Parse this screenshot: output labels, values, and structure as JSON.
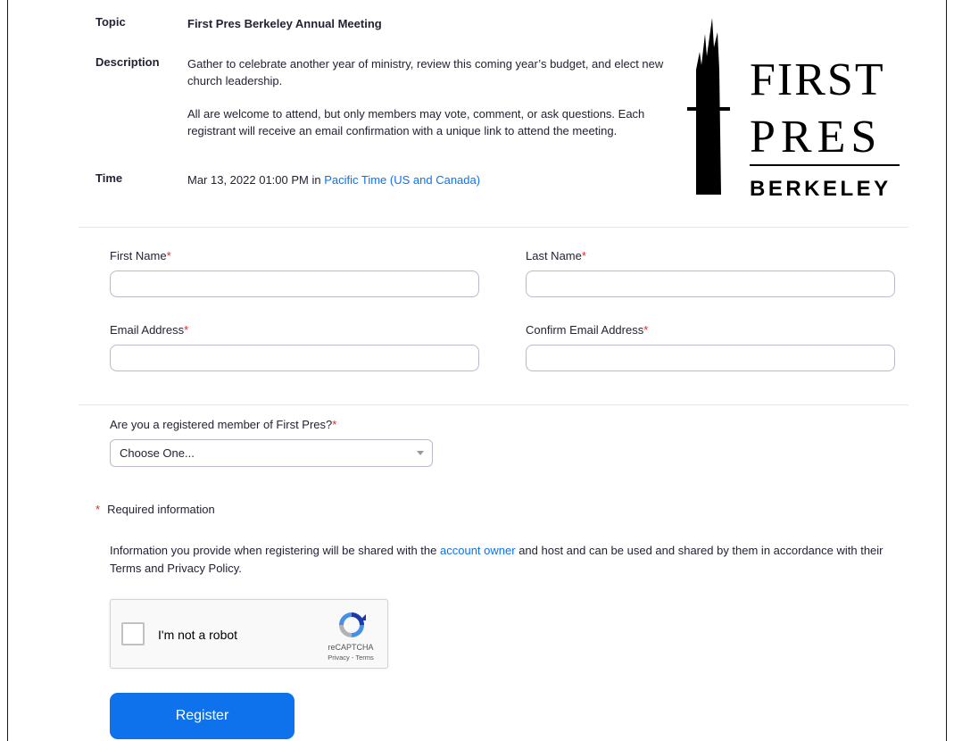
{
  "meeting": {
    "topic_label": "Topic",
    "topic": "First Pres Berkeley Annual Meeting",
    "description_label": "Description",
    "description_p1": "Gather to celebrate another year of ministry, review this coming year’s budget, and elect new church leadership.",
    "description_p2": "All are welcome to attend, but only members may vote, comment, or ask questions. Each registrant will receive an email confirmation with a unique link to attend the meeting.",
    "time_label": "Time",
    "time_value": "Mar 13, 2022 01:00 PM in",
    "timezone_link": "Pacific Time (US and Canada)"
  },
  "logo": {
    "line1": "FIRST",
    "line2": "PRES",
    "line3": "BERKELEY",
    "icon": "church-spire-cross-logo"
  },
  "form": {
    "required_mark": "*",
    "first_name_label": "First Name",
    "last_name_label": "Last Name",
    "email_label": "Email Address",
    "confirm_email_label": "Confirm Email Address",
    "first_name_value": "",
    "last_name_value": "",
    "email_value": "",
    "confirm_email_value": "",
    "member_question": "Are you a registered member of First Pres?",
    "member_selected": "Choose One...",
    "required_info": "Required information"
  },
  "disclaimer": {
    "before": "Information you provide when registering will be shared with the",
    "link": "account owner",
    "after": "and host and can be used and shared by them in accordance with their Terms and Privacy Policy."
  },
  "captcha": {
    "label": "I'm not a robot",
    "brand": "reCAPTCHA",
    "links": "Privacy - Terms"
  },
  "register_label": "Register",
  "colors": {
    "accent": "#0e72ed",
    "required": "#e02828"
  }
}
